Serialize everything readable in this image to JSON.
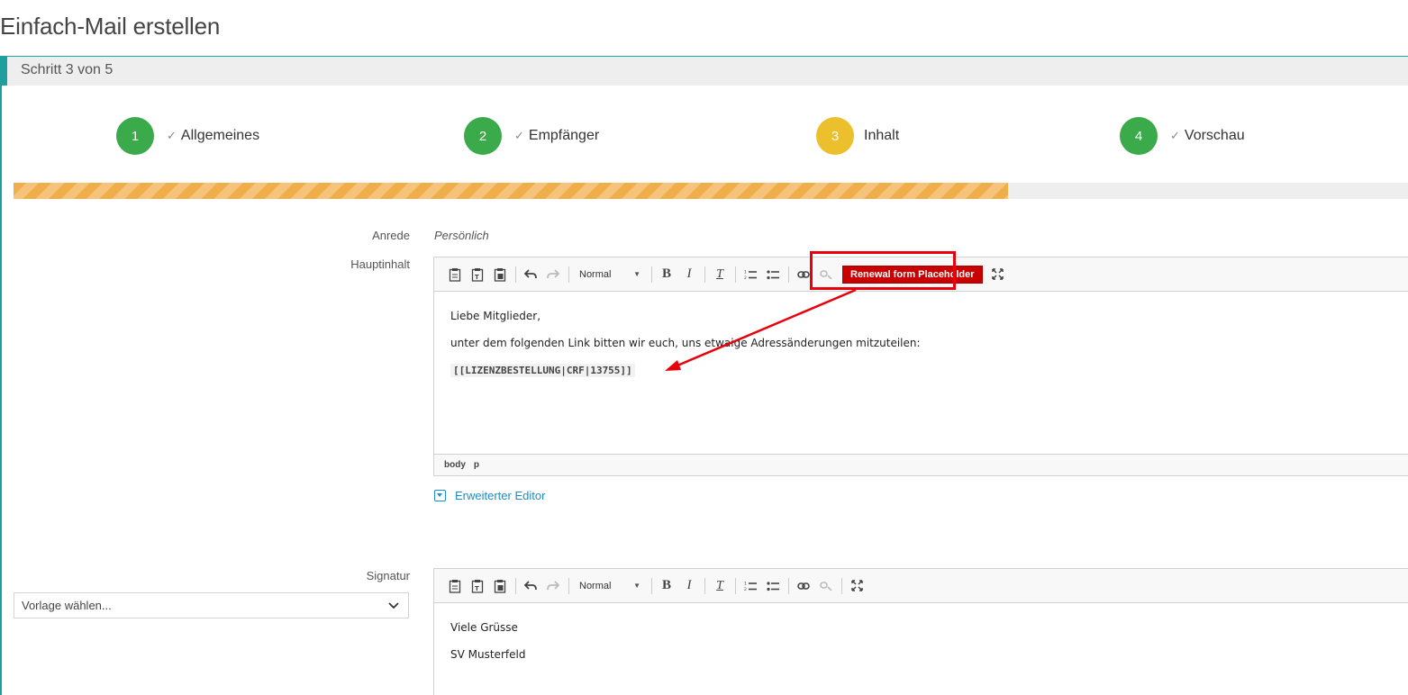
{
  "page": {
    "title": "Einfach-Mail erstellen"
  },
  "step_header": {
    "text": "Schritt 3 von 5"
  },
  "wizard": {
    "steps": [
      {
        "number": "1",
        "label": "Allgemeines",
        "check": "✓"
      },
      {
        "number": "2",
        "label": "Empfänger",
        "check": "✓"
      },
      {
        "number": "3",
        "label": "Inhalt",
        "check": ""
      },
      {
        "number": "4",
        "label": "Vorschau",
        "check": "✓"
      }
    ],
    "progress_fraction": 0.713
  },
  "form": {
    "anrede_label": "Anrede",
    "anrede_value": "Persönlich",
    "hauptinhalt_label": "Hauptinhalt",
    "signatur_label": "Signatur"
  },
  "main_editor": {
    "format_value": "Normal",
    "placeholder_button": "Renewal form Placeholder",
    "paragraphs": [
      "Liebe Mitglieder,",
      "unter dem folgenden Link bitten wir euch, uns etwaige Adressänderungen mitzuteilen:"
    ],
    "placeholder_text": "[[LIZENZBESTELLUNG|CRF|13755]]",
    "status_path": [
      "body",
      "p"
    ]
  },
  "advanced_editor": {
    "label": "Erweiterter Editor"
  },
  "signature": {
    "template_select": "Vorlage wählen...",
    "format_value": "Normal",
    "lines": [
      "Viele Grüsse",
      "SV Musterfeld"
    ]
  },
  "colors": {
    "teal_accent": "#1f9e9e",
    "step_done": "#3aaa4a",
    "step_active": "#ecc02c",
    "progress": "#f0ae4a",
    "annotation_red": "#e8000b",
    "placeholder_button": "#c90000",
    "link_blue": "#1a8fc6"
  },
  "icons": {
    "paste": "paste-icon",
    "paste_text": "paste-text-icon",
    "paste_word": "paste-word-icon",
    "undo": "undo-icon",
    "redo": "redo-icon",
    "bold": "bold-icon",
    "italic": "italic-icon",
    "remove_format": "remove-format-icon",
    "numbered_list": "numbered-list-icon",
    "bulleted_list": "bulleted-list-icon",
    "link": "link-icon",
    "unlink": "unlink-icon",
    "maximize": "maximize-icon",
    "dropdown": "chevron-down-icon"
  }
}
